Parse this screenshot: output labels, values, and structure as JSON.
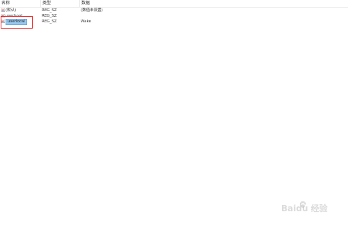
{
  "columns": {
    "name": "名称",
    "type": "类型",
    "data": "数据"
  },
  "rows": [
    {
      "name": "(默认)",
      "type": "REG_SZ",
      "data": "(数值未设置)",
      "icon": "reg-string-icon",
      "selected": false
    },
    {
      "name": "userboot",
      "type": "REG_SZ",
      "data": "",
      "icon": "reg-string-icon",
      "selected": false
    },
    {
      "name": "userlocal",
      "type": "REG_SZ",
      "data": "Wake",
      "icon": "reg-string-icon",
      "selected": true
    }
  ],
  "annotation": {
    "color": "#ee2222"
  },
  "watermark": {
    "text": "Baidu 经验"
  },
  "colors": {
    "selection": "#99c9ef",
    "icon_red": "#c8453a",
    "icon_blue": "#3f6fb6"
  }
}
